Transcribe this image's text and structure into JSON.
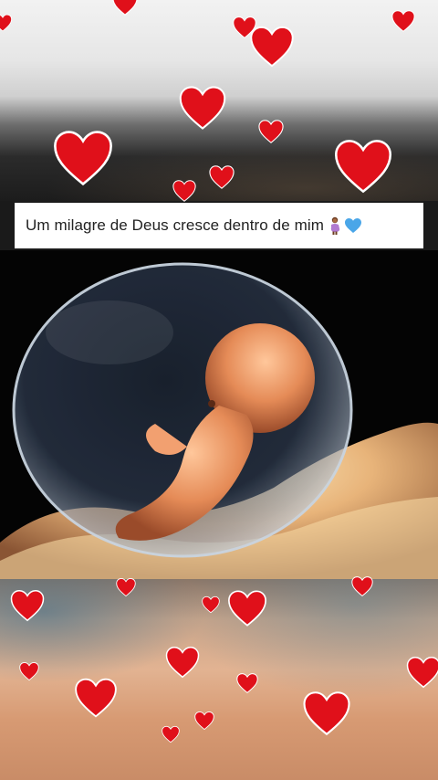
{
  "caption": {
    "text": "Um milagre de Deus cresce dentro de mim",
    "emoji": [
      "pregnant-person-emoji",
      "blue-heart-emoji"
    ]
  },
  "photo": {
    "subject": "embryo-in-amniotic-sac-image"
  },
  "colors": {
    "heart": "#e0101a",
    "heart_outline": "#ffffff",
    "emoji_heart": "#4aa6e8",
    "caption_bg": "#ffffff",
    "caption_text": "#222222"
  }
}
